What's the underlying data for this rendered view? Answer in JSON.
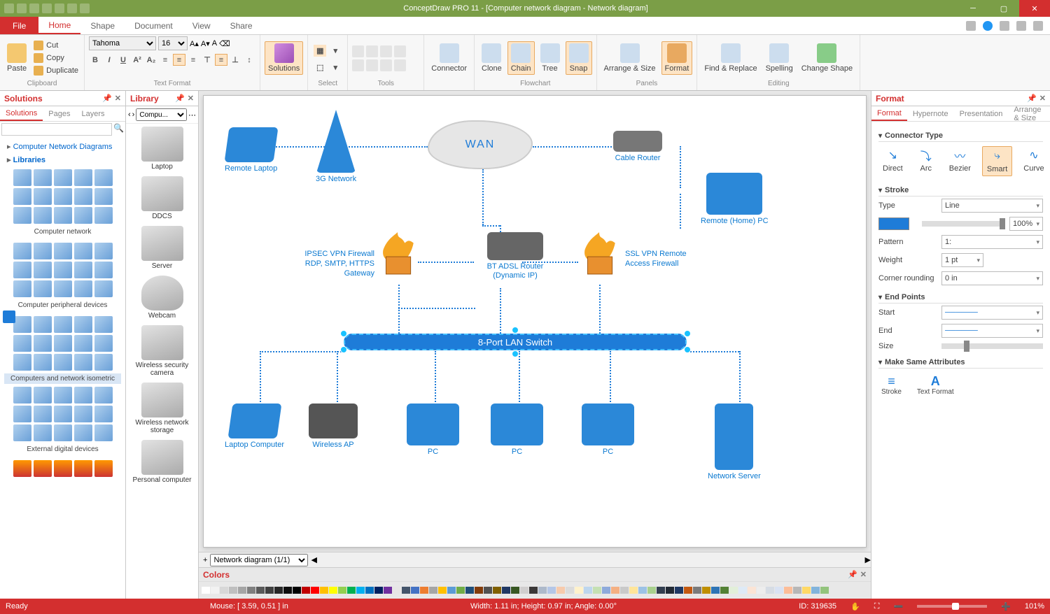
{
  "titlebar": {
    "title": "ConceptDraw PRO 11 - [Computer network diagram - Network diagram]"
  },
  "menubar": {
    "file": "File",
    "tabs": [
      "Home",
      "Shape",
      "Document",
      "View",
      "Share"
    ],
    "active": "Home"
  },
  "ribbon": {
    "clipboard": {
      "label": "Clipboard",
      "paste": "Paste",
      "cut": "Cut",
      "copy": "Copy",
      "duplicate": "Duplicate"
    },
    "textformat": {
      "label": "Text Format",
      "font": "Tahoma",
      "size": "16"
    },
    "solutions": {
      "label": "Solutions"
    },
    "select": {
      "label": "Select"
    },
    "tools": {
      "label": "Tools"
    },
    "connector": "Connector",
    "flowchart": {
      "label": "Flowchart",
      "clone": "Clone",
      "chain": "Chain",
      "tree": "Tree",
      "snap": "Snap"
    },
    "panels": {
      "label": "Panels",
      "arrange": "Arrange & Size",
      "format": "Format"
    },
    "editing": {
      "label": "Editing",
      "find": "Find & Replace",
      "spelling": "Spelling",
      "change": "Change Shape"
    }
  },
  "solpanel": {
    "title": "Solutions",
    "tabs": [
      "Solutions",
      "Pages",
      "Layers"
    ],
    "tree1": "Computer Network Diagrams",
    "tree2": "Libraries",
    "groups": [
      "Computer network",
      "Computer peripheral devices",
      "Computers and network isometric",
      "External digital devices"
    ]
  },
  "libpanel": {
    "title": "Library",
    "combo": "Compu...",
    "items": [
      "Laptop",
      "DDCS",
      "Server",
      "Webcam",
      "Wireless security camera",
      "Wireless network storage",
      "Personal computer"
    ]
  },
  "canvas": {
    "wan": "WAN",
    "nodes": {
      "remote_laptop": "Remote Laptop",
      "threeg": "3G Network",
      "cable_router": "Cable Router",
      "remote_pc": "Remote (Home) PC",
      "ipsec": "IPSEC VPN Firewall RDP, SMTP, HTTPS Gateway",
      "bt_adsl": "BT ADSL Router (Dynamic IP)",
      "ssl": "SSL VPN Remote Access Firewall",
      "lan": "8-Port LAN Switch",
      "laptop_computer": "Laptop Computer",
      "wireless_ap": "Wireless AP",
      "pc": "PC",
      "network_server": "Network Server"
    }
  },
  "doc_tab": "Network diagram (1/1)",
  "colors_title": "Colors",
  "fmt": {
    "title": "Format",
    "tabs": [
      "Format",
      "Hypernote",
      "Presentation",
      "Arrange & Size"
    ],
    "sections": {
      "conntype": "Connector Type",
      "stroke": "Stroke",
      "endpoints": "End Points",
      "same": "Make Same Attributes"
    },
    "conn_labels": [
      "Direct",
      "Arc",
      "Bezier",
      "Smart",
      "Curve"
    ],
    "stroke_type_label": "Type",
    "stroke_type_val": "Line",
    "opacity": "100%",
    "pattern_label": "Pattern",
    "pattern_val": "1:",
    "weight_label": "Weight",
    "weight_val": "1 pt",
    "corner_label": "Corner rounding",
    "corner_val": "0 in",
    "start_label": "Start",
    "end_label": "End",
    "size_label": "Size",
    "attr_stroke": "Stroke",
    "attr_text": "Text Format"
  },
  "status": {
    "ready": "Ready",
    "mouse": "Mouse: [ 3.59, 0.51 ] in",
    "dims": "Width: 1.11 in;  Height: 0.97 in;  Angle: 0.00°",
    "id": "ID: 319635",
    "zoom": "101%"
  },
  "swatches": [
    "#ffffff",
    "#f2f2f2",
    "#d8d8d8",
    "#bfbfbf",
    "#a5a5a5",
    "#7f7f7f",
    "#595959",
    "#3f3f3f",
    "#262626",
    "#0c0c0c",
    "#000000",
    "#c00000",
    "#ff0000",
    "#ffc000",
    "#ffff00",
    "#92d050",
    "#00b050",
    "#00b0f0",
    "#0070c0",
    "#002060",
    "#7030a0",
    "#e7e6e6",
    "#44546a",
    "#4472c4",
    "#ed7d31",
    "#a5a5a5",
    "#ffc000",
    "#5b9bd5",
    "#70ad47",
    "#1f4e79",
    "#833c0b",
    "#525252",
    "#806000",
    "#203864",
    "#385723",
    "#d0cece",
    "#3b3838",
    "#adb9ca",
    "#b4c6e7",
    "#f7caac",
    "#dbdbdb",
    "#fff2cc",
    "#bdd6ee",
    "#c5e0b3",
    "#8eaadb",
    "#f4b083",
    "#c9c9c9",
    "#ffe599",
    "#9cc2e5",
    "#a8d08d",
    "#323e4f",
    "#222a35",
    "#1f3864",
    "#c45911",
    "#7b7b7b",
    "#bf8f00",
    "#2e74b5",
    "#538135",
    "#e2efd9",
    "#deeaf6",
    "#fbe4d5",
    "#ededed",
    "#d6dce4",
    "#d9e2f3",
    "#fcbd98",
    "#b7b7b7",
    "#ffd966",
    "#82b4dc",
    "#93c47d"
  ]
}
